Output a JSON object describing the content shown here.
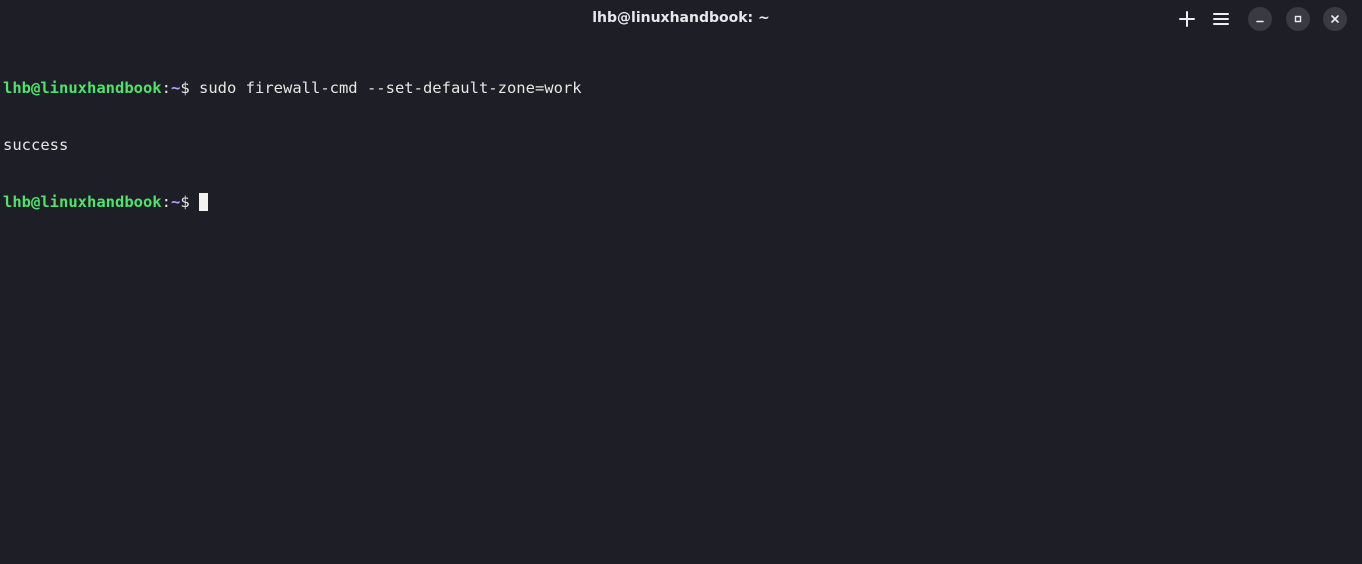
{
  "window": {
    "title": "lhb@linuxhandbook: ~"
  },
  "header_buttons": {
    "new_tab_icon": "plus-icon",
    "menu_icon": "hamburger-menu-icon",
    "minimize_icon": "minimize-icon",
    "maximize_icon": "maximize-icon",
    "close_icon": "close-icon"
  },
  "terminal": {
    "lines": [
      {
        "user_host": "lhb@linuxhandbook",
        "colon": ":",
        "path": "~",
        "prompt_symbol": "$ ",
        "command": "sudo firewall-cmd --set-default-zone=work"
      },
      {
        "output": "success"
      },
      {
        "user_host": "lhb@linuxhandbook",
        "colon": ":",
        "path": "~",
        "prompt_symbol": "$ ",
        "command": ""
      }
    ]
  },
  "colors": {
    "background": "#1e1e26",
    "user_host": "#4fe36b",
    "path": "#a9a9ff",
    "text": "#e6e6e6"
  }
}
